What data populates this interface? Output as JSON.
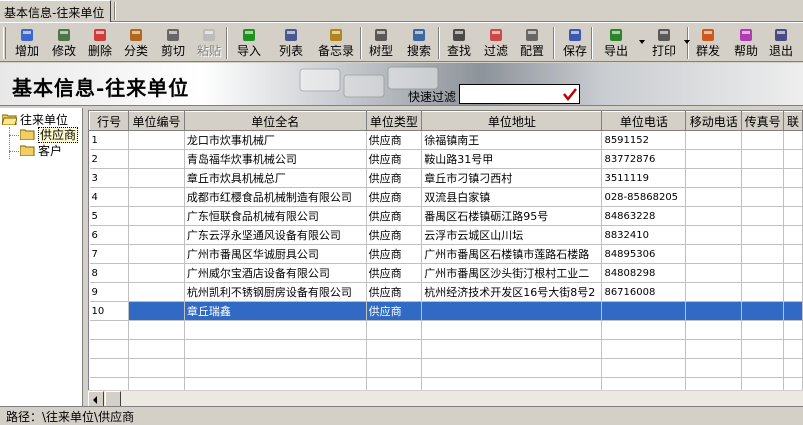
{
  "tab": {
    "label": "基本信息-往来单位"
  },
  "toolbar": {
    "buttons": [
      {
        "label": "增加",
        "icon": "add-icon"
      },
      {
        "label": "修改",
        "icon": "edit-icon"
      },
      {
        "label": "删除",
        "icon": "delete-icon"
      },
      {
        "label": "分类",
        "icon": "category-icon"
      },
      {
        "label": "剪切",
        "icon": "scissors-icon"
      },
      {
        "label": "粘贴",
        "icon": "paste-icon"
      },
      {
        "label": "导入",
        "icon": "import-icon"
      },
      {
        "label": "列表",
        "icon": "list-icon"
      },
      {
        "label": "备忘录",
        "icon": "memo-icon"
      },
      {
        "label": "树型",
        "icon": "tree-icon"
      },
      {
        "label": "搜索",
        "icon": "search-icon"
      },
      {
        "label": "查找",
        "icon": "binoculars-icon"
      },
      {
        "label": "过滤",
        "icon": "filter-icon"
      },
      {
        "label": "配置",
        "icon": "config-icon"
      },
      {
        "label": "保存",
        "icon": "save-icon"
      },
      {
        "label": "导出",
        "icon": "export-icon"
      },
      {
        "label": "打印",
        "icon": "print-icon"
      },
      {
        "label": "群发",
        "icon": "broadcast-icon"
      },
      {
        "label": "帮助",
        "icon": "help-icon"
      },
      {
        "label": "退出",
        "icon": "exit-icon"
      }
    ]
  },
  "banner": {
    "title": "基本信息-往来单位",
    "filter_label": "快速过滤",
    "filter_value": ""
  },
  "tree": {
    "root": "往来单位",
    "children": [
      "供应商",
      "客户"
    ]
  },
  "grid": {
    "columns": [
      "行号",
      "单位编号",
      "单位全名",
      "单位类型",
      "单位地址",
      "单位电话",
      "移动电话",
      "传真号",
      "联"
    ],
    "rows": [
      {
        "no": "1",
        "code": "",
        "name": "龙口市炊事机械厂",
        "type": "供应商",
        "address": "徐福镇南王",
        "phone": "8591152",
        "mobile": "",
        "fax": "",
        "contact": ""
      },
      {
        "no": "2",
        "code": "",
        "name": "青岛福华炊事机械公司",
        "type": "供应商",
        "address": "鞍山路31号甲",
        "phone": "83772876",
        "mobile": "",
        "fax": "",
        "contact": ""
      },
      {
        "no": "3",
        "code": "",
        "name": "章丘市炊具机械总厂",
        "type": "供应商",
        "address": "章丘市刁镇刁西村",
        "phone": "3511119",
        "mobile": "",
        "fax": "",
        "contact": ""
      },
      {
        "no": "4",
        "code": "",
        "name": "成都市红樱食品机械制造有限公司",
        "type": "供应商",
        "address": "双流县白家镇",
        "phone": "028-85868205",
        "mobile": "",
        "fax": "",
        "contact": ""
      },
      {
        "no": "5",
        "code": "",
        "name": "广东恒联食品机械有限公司",
        "type": "供应商",
        "address": "番禺区石楼镇砺江路95号",
        "phone": "84863228",
        "mobile": "",
        "fax": "",
        "contact": ""
      },
      {
        "no": "6",
        "code": "",
        "name": "广东云浮永坚通风设备有限公司",
        "type": "供应商",
        "address": "云浮市云城区山川坛",
        "phone": "8832410",
        "mobile": "",
        "fax": "",
        "contact": ""
      },
      {
        "no": "7",
        "code": "",
        "name": "广州市番禺区华诚厨具公司",
        "type": "供应商",
        "address": "广州市番禺区石楼镇市莲路石楼路",
        "phone": "84895306",
        "mobile": "",
        "fax": "",
        "contact": ""
      },
      {
        "no": "8",
        "code": "",
        "name": "广州威尔宝酒店设备有限公司",
        "type": "供应商",
        "address": "广州市番禺区沙头街汀根村工业二",
        "phone": "84808298",
        "mobile": "",
        "fax": "",
        "contact": ""
      },
      {
        "no": "9",
        "code": "",
        "name": "杭州凯利不锈钢厨房设备有限公司",
        "type": "供应商",
        "address": "杭州经济技术开发区16号大街8号2",
        "phone": "86716008",
        "mobile": "",
        "fax": "",
        "contact": ""
      },
      {
        "no": "10",
        "code": "",
        "name": "章丘瑞鑫",
        "type": "供应商",
        "address": "",
        "phone": "",
        "mobile": "",
        "fax": "",
        "contact": ""
      }
    ],
    "selected_row": "10"
  },
  "status": {
    "path": "路径：\\往来单位\\供应商"
  },
  "colors": {
    "selection": "#316ac5",
    "chrome": "#d4d0c8"
  }
}
